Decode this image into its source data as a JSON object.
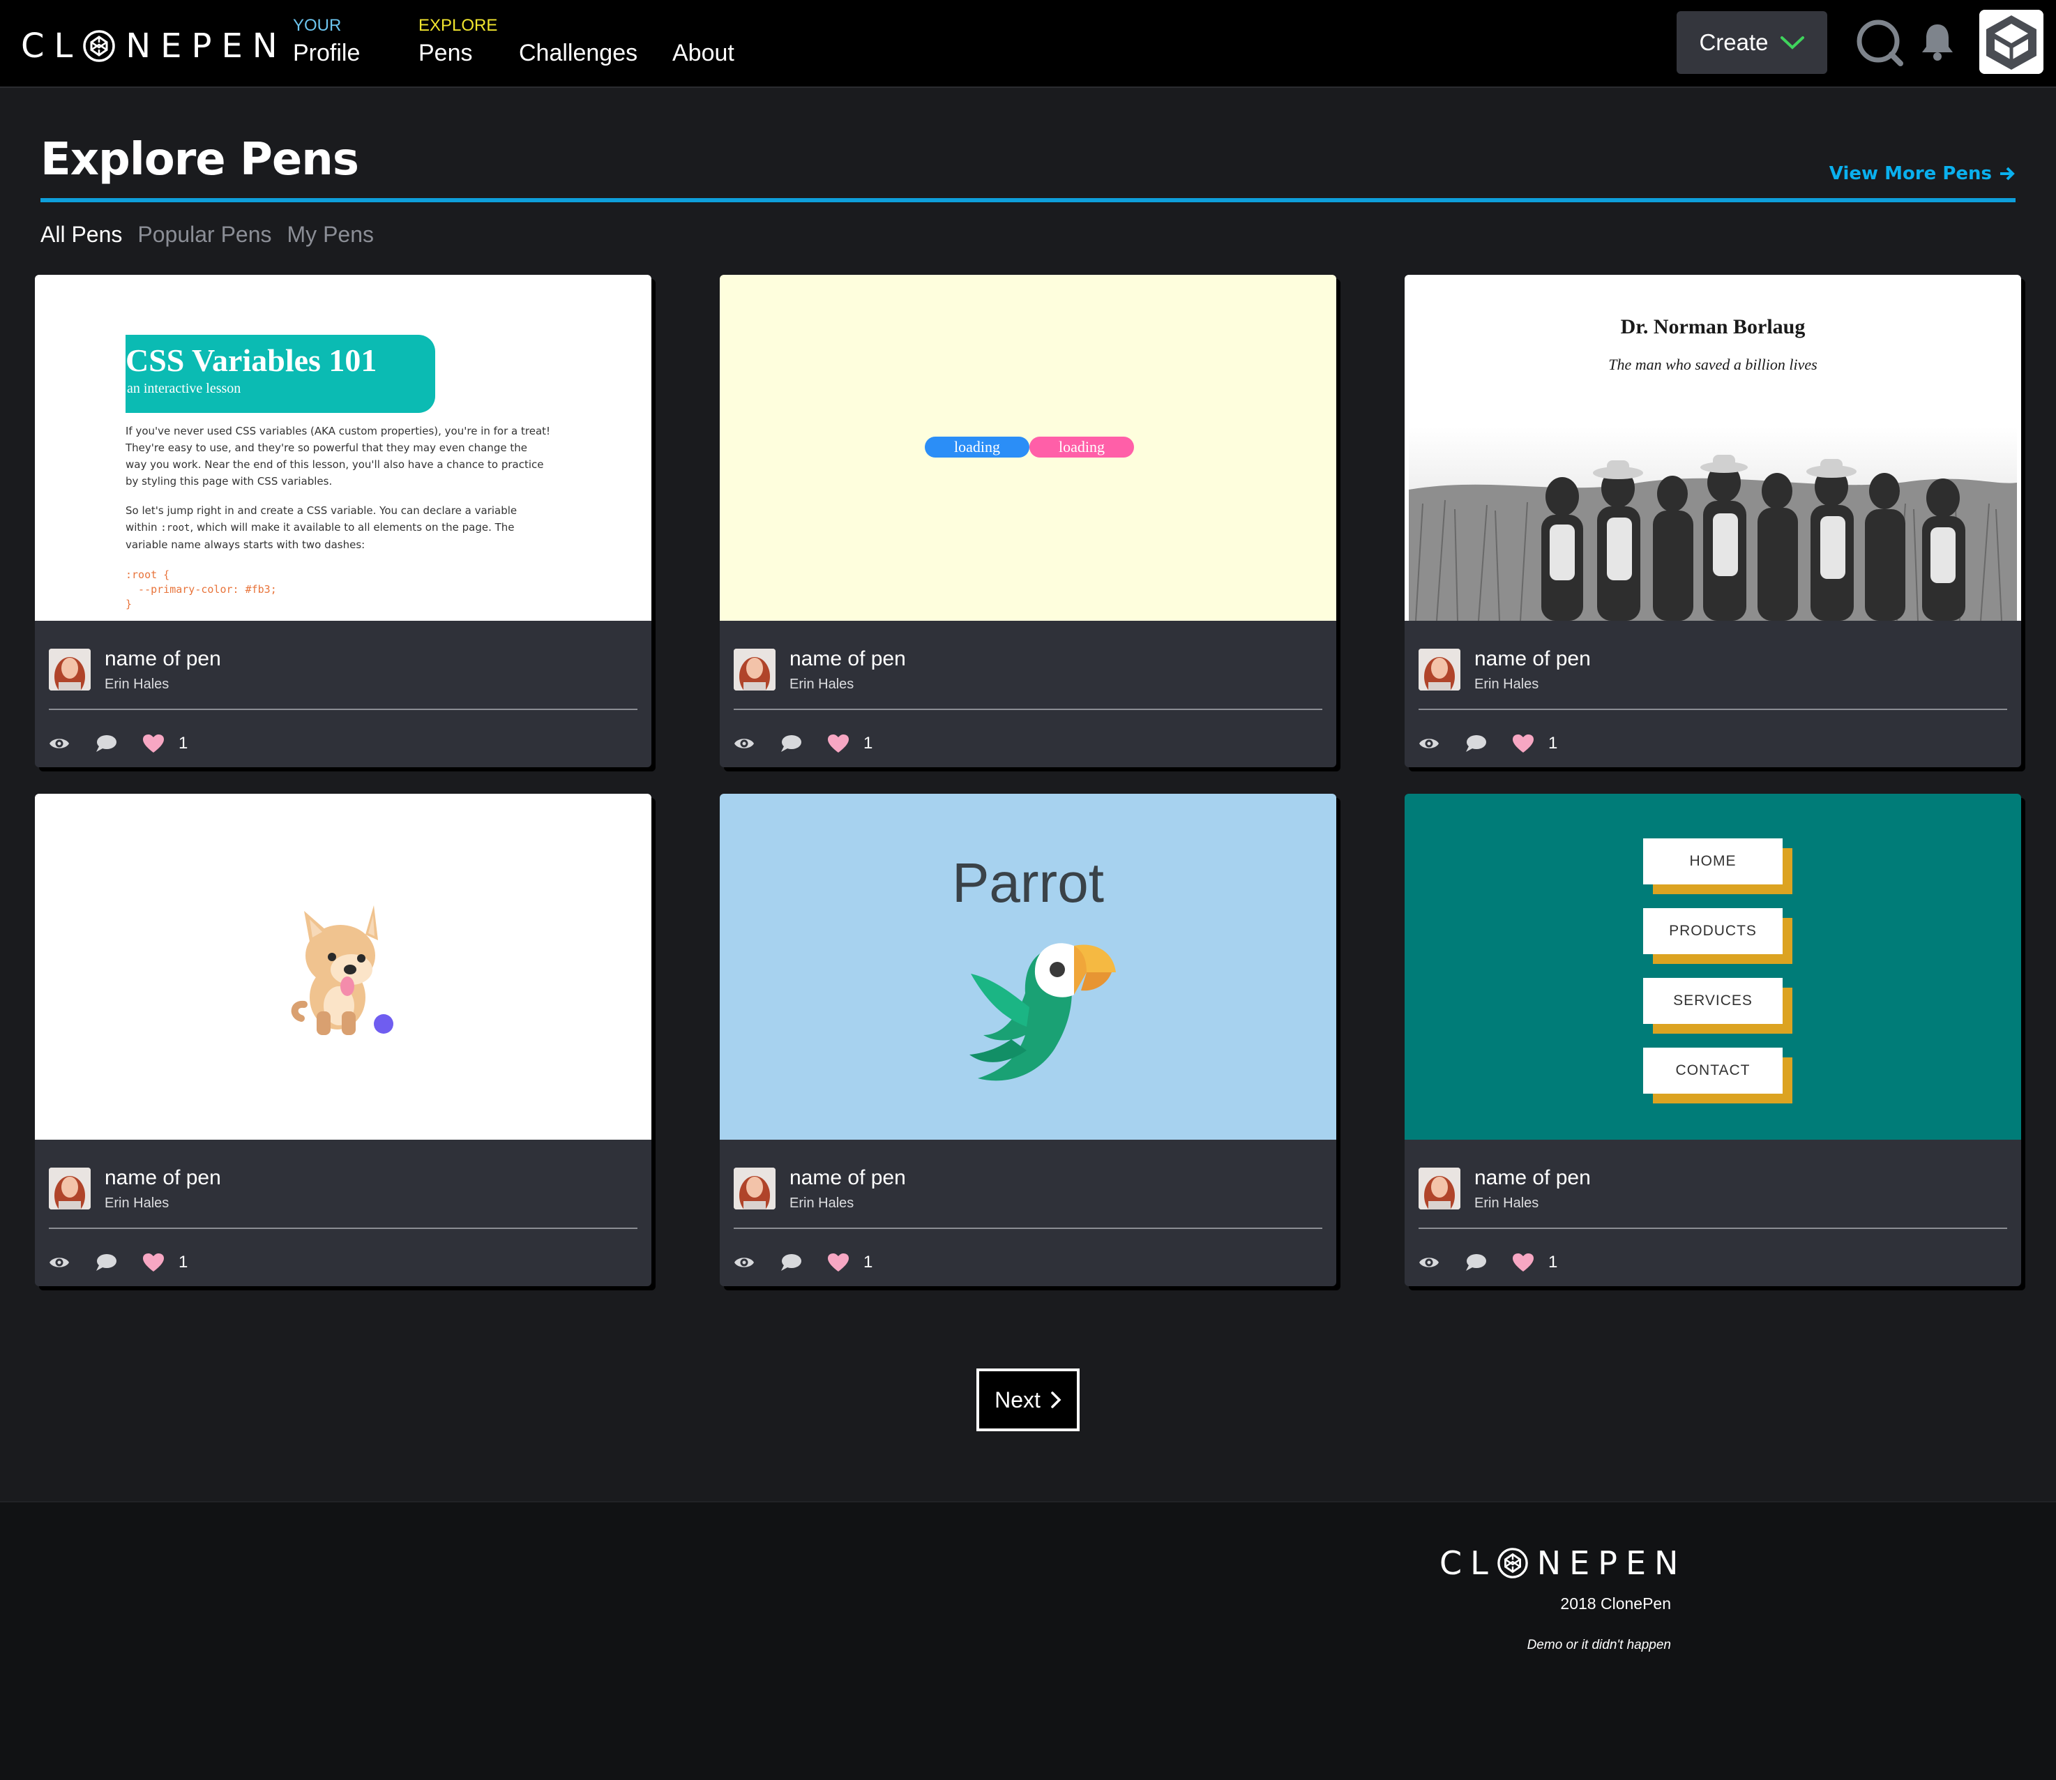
{
  "brand": {
    "logo_left": "CL",
    "logo_right": "NEPEN"
  },
  "nav": {
    "items": [
      {
        "small": "YOUR",
        "label": "Profile"
      },
      {
        "small": "EXPLORE",
        "label": "Pens"
      },
      {
        "small": "",
        "label": "Challenges"
      },
      {
        "small": "",
        "label": "About"
      }
    ],
    "create_label": "Create",
    "icons": [
      "search-icon",
      "bell-icon",
      "avatar"
    ]
  },
  "page": {
    "title": "Explore Pens",
    "view_more": "View More Pens",
    "tabs": [
      "All Pens",
      "Popular Pens",
      "My Pens"
    ],
    "active_tab": "All Pens"
  },
  "previews": {
    "css": {
      "title": "CSS Variables 101",
      "subtitle": "an interactive lesson",
      "p1": "If you've never used CSS variables (AKA custom properties), you're in for a treat! They're easy to use, and they're so powerful that they may even change the way you work. Near the end of this lesson, you'll also have a chance to practice by styling this page with CSS variables.",
      "p2a": "So let's jump right in and create a CSS variable. You can declare a variable within",
      "p2code": ":root",
      "p2b": ", which will make it available to all elements on the page. The variable name always starts with two dashes:",
      "code": ":root {\n  --primary-color: #fb3;\n}"
    },
    "loading": {
      "left": "loading",
      "right": "loading"
    },
    "photo": {
      "title": "Dr. Norman Borlaug",
      "subtitle": "The man who saved a billion lives"
    },
    "parrot": {
      "word": "Parrot"
    },
    "menu": {
      "items": [
        "HOME",
        "PRODUCTS",
        "SERVICES",
        "CONTACT"
      ]
    }
  },
  "pens": [
    {
      "name": "name of pen",
      "author": "Erin Hales",
      "likes": "1"
    },
    {
      "name": "name of pen",
      "author": "Erin Hales",
      "likes": "1"
    },
    {
      "name": "name of pen",
      "author": "Erin Hales",
      "likes": "1"
    },
    {
      "name": "name of pen",
      "author": "Erin Hales",
      "likes": "1"
    },
    {
      "name": "name of pen",
      "author": "Erin Hales",
      "likes": "1"
    },
    {
      "name": "name of pen",
      "author": "Erin Hales",
      "likes": "1"
    }
  ],
  "pagination": {
    "next_label": "Next"
  },
  "footer": {
    "copyright": "2018 ClonePen",
    "tagline": "Demo or it didn't happen"
  },
  "colors": {
    "accent": "#0e9fdb",
    "profile_label": "#6cc4ee",
    "pens_label": "#f1e52e",
    "card_bg": "#2f3139",
    "heart": "#f7a7c3",
    "teal": "#0bbbb3"
  }
}
